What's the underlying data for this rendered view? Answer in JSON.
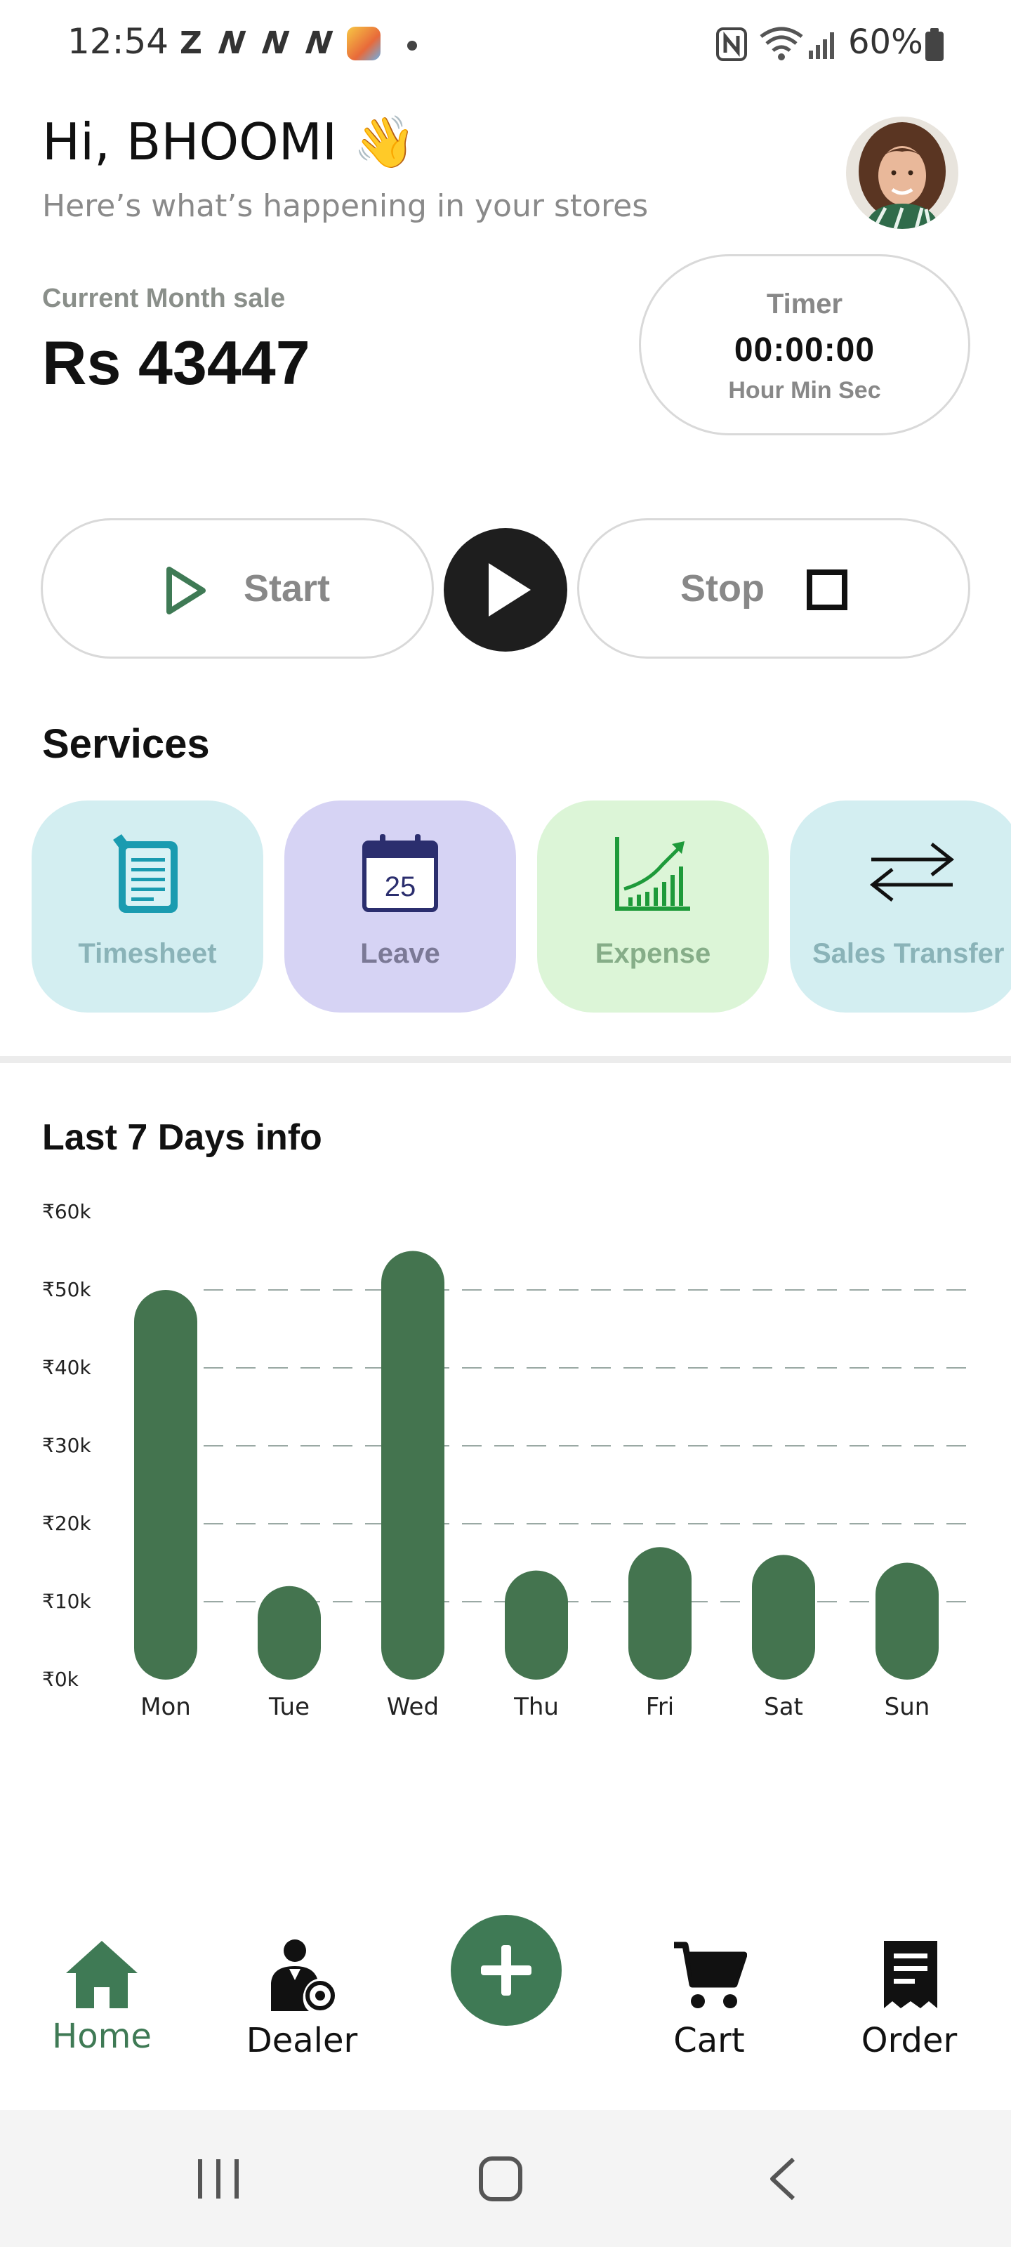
{
  "status_bar": {
    "time": "12:54",
    "z_icon": "Z",
    "n_icons": [
      "N",
      "N",
      "N"
    ],
    "battery_percent": "60%",
    "icons": [
      "nfc-icon",
      "wifi-icon",
      "signal-icon",
      "battery-icon"
    ]
  },
  "header": {
    "greeting": "Hi, BHOOMI",
    "greeting_emoji": "👋",
    "subtitle": "Here’s what’s happening in your stores"
  },
  "sales": {
    "label": "Current Month sale",
    "value": "Rs 43447"
  },
  "timer": {
    "title": "Timer",
    "value": "00:00:00",
    "units": "Hour Min Sec"
  },
  "controls": {
    "start_label": "Start",
    "stop_label": "Stop"
  },
  "services": {
    "title": "Services",
    "items": [
      {
        "label": "Timesheet",
        "icon": "timesheet-icon",
        "bg": "#d3eef1",
        "text_color": "#8ab3b8"
      },
      {
        "label": "Leave",
        "icon": "calendar-icon",
        "bg": "#d6d3f4",
        "text_color": "#7b7996",
        "day": "25"
      },
      {
        "label": "Expense",
        "icon": "growth-chart-icon",
        "bg": "#dcf5d7",
        "text_color": "#86ad88"
      },
      {
        "label": "Sales Transfer",
        "icon": "transfer-arrows-icon",
        "bg": "#d3eef1",
        "text_color": "#8ab3b8"
      }
    ]
  },
  "chart_section": {
    "title": "Last 7 Days info"
  },
  "chart_data": {
    "type": "bar",
    "categories": [
      "Mon",
      "Tue",
      "Wed",
      "Thu",
      "Fri",
      "Sat",
      "Sun"
    ],
    "values": [
      50000,
      12000,
      55000,
      14000,
      17000,
      16000,
      15000
    ],
    "y_ticks": [
      "₹0k",
      "₹10k",
      "₹20k",
      "₹30k",
      "₹40k",
      "₹50k",
      "₹60k"
    ],
    "ylim": [
      0,
      60000
    ],
    "grid": "dashed",
    "bar_color": "#44744f"
  },
  "bottom_nav": {
    "items": [
      {
        "label": "Home",
        "icon": "home-icon",
        "active": true
      },
      {
        "label": "Dealer",
        "icon": "dealer-icon",
        "active": false
      },
      {
        "label": "Cart",
        "icon": "cart-icon",
        "active": false
      },
      {
        "label": "Order",
        "icon": "order-receipt-icon",
        "active": false
      }
    ],
    "fab_icon": "plus-icon"
  },
  "colors": {
    "accent": "#3f7a55",
    "bar": "#44744f"
  }
}
